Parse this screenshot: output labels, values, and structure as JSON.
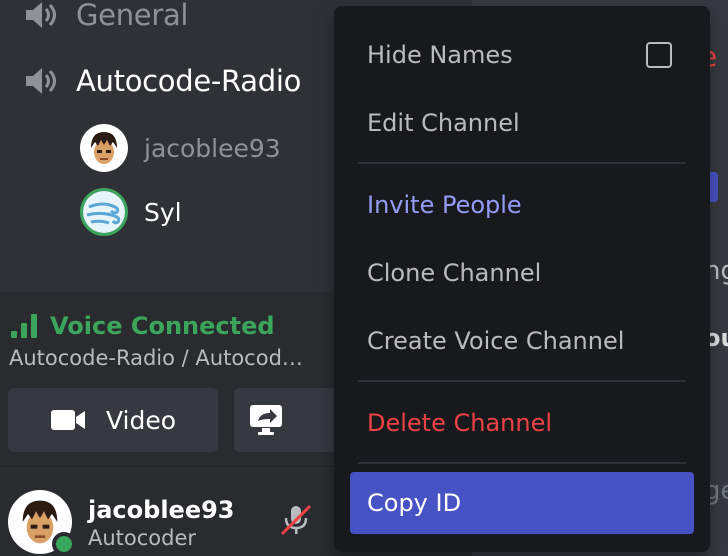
{
  "channels": [
    {
      "name": "General",
      "icon": "speaker-icon"
    },
    {
      "name": "Autocode-Radio",
      "icon": "speaker-icon"
    }
  ],
  "voice_users": [
    {
      "name": "jacoblee93",
      "speaking": false
    },
    {
      "name": "Syl",
      "speaking": true
    }
  ],
  "voice_panel": {
    "status": "Voice Connected",
    "location": "Autocode-Radio / Autocod…",
    "video_label": "Video",
    "status_color": "#3ba55c"
  },
  "user": {
    "name": "jacoblee93",
    "subtitle": "Autocoder",
    "status": "online"
  },
  "context_menu": {
    "hide_names": "Hide Names",
    "hide_names_checked": false,
    "edit_channel": "Edit Channel",
    "invite_people": "Invite People",
    "clone_channel": "Clone Channel",
    "create_voice_channel": "Create Voice Channel",
    "delete_channel": "Delete Channel",
    "copy_id": "Copy ID"
  },
  "right_fragments": {
    "f1": "e",
    "f3": "ng",
    "f4": "ou",
    "f5": "ge"
  },
  "colors": {
    "accent": "#4752c4",
    "invite": "#949cf7",
    "danger": "#ed4245",
    "online": "#3ba55c"
  }
}
